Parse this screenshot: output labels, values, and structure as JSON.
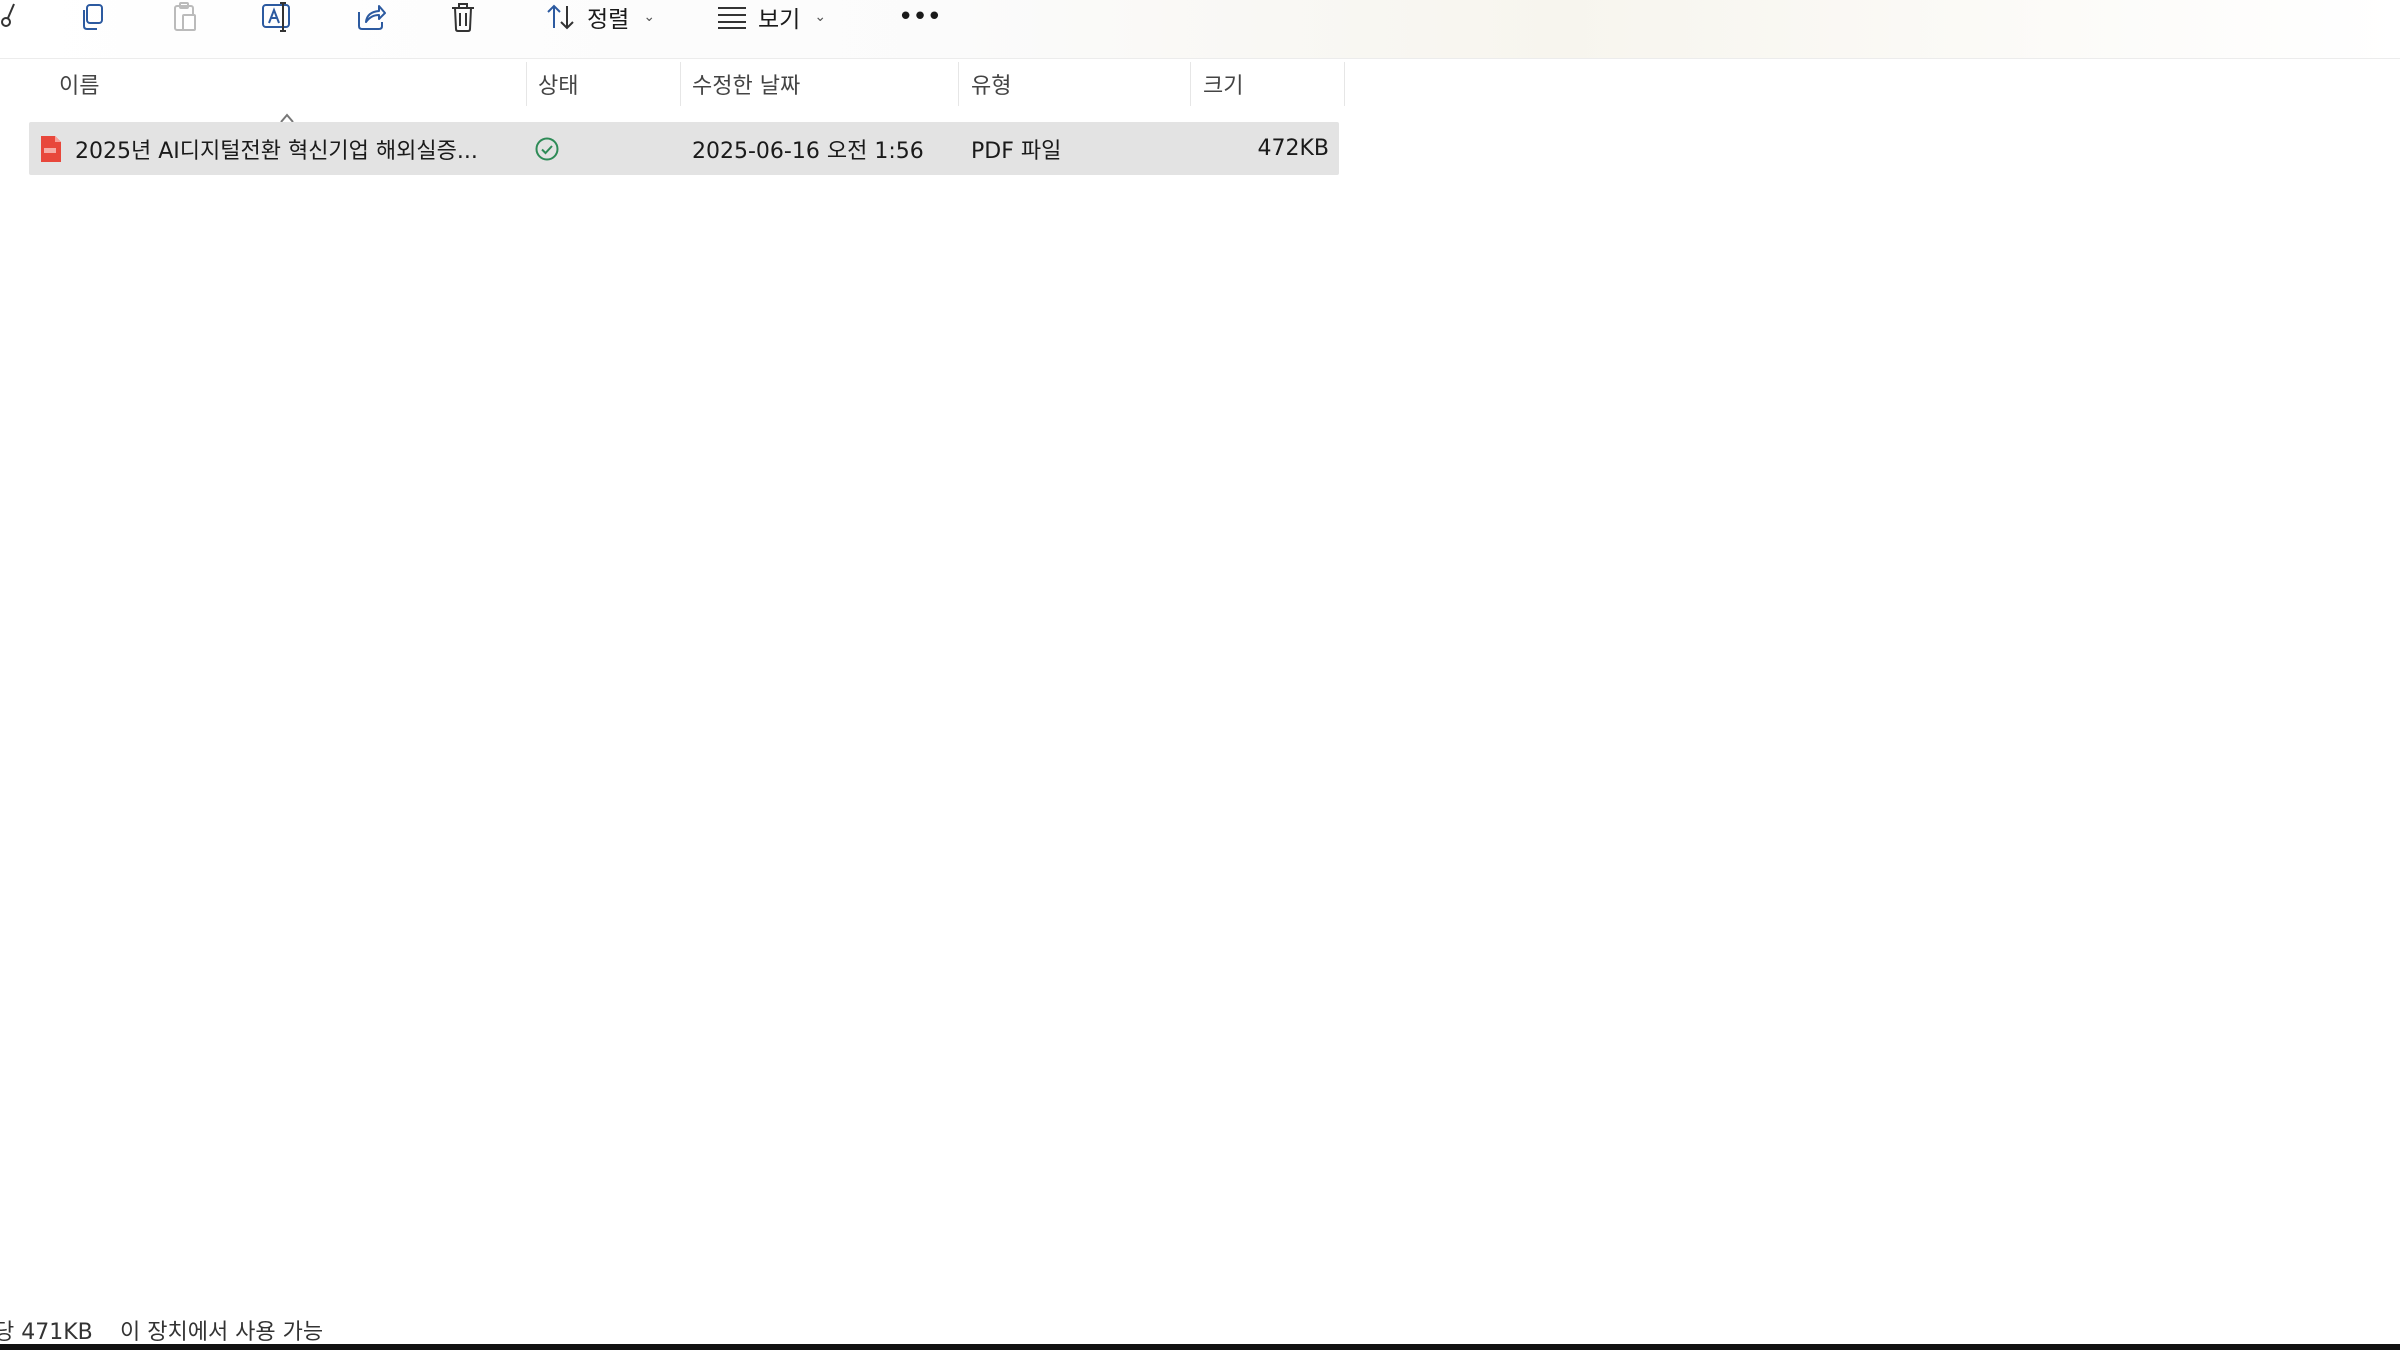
{
  "toolbar": {
    "icons": [
      "cut-icon",
      "copy-icon",
      "paste-icon",
      "rename-icon",
      "share-icon",
      "delete-icon"
    ],
    "sort_label": "정렬",
    "view_label": "보기",
    "more_label": "•••"
  },
  "columns": {
    "name": "이름",
    "status": "상태",
    "modified": "수정한 날짜",
    "type": "유형",
    "size": "크기",
    "sorted_by": "name",
    "sort_direction": "ascending"
  },
  "files": [
    {
      "name": "2025년 AI디지털전환 혁신기업 해외실증...",
      "status": "available-on-device",
      "modified": "2025-06-16 오전 1:56",
      "type": "PDF 파일",
      "size": "472KB",
      "icon": "pdf-file-icon",
      "selected": true
    }
  ],
  "statusbar": {
    "selection_size": "당 471KB",
    "availability": "이 장치에서 사용 가능"
  },
  "colors": {
    "selection": "#e3e3e3",
    "status_ok": "#2e8b57",
    "pdf_red": "#e8473b"
  }
}
